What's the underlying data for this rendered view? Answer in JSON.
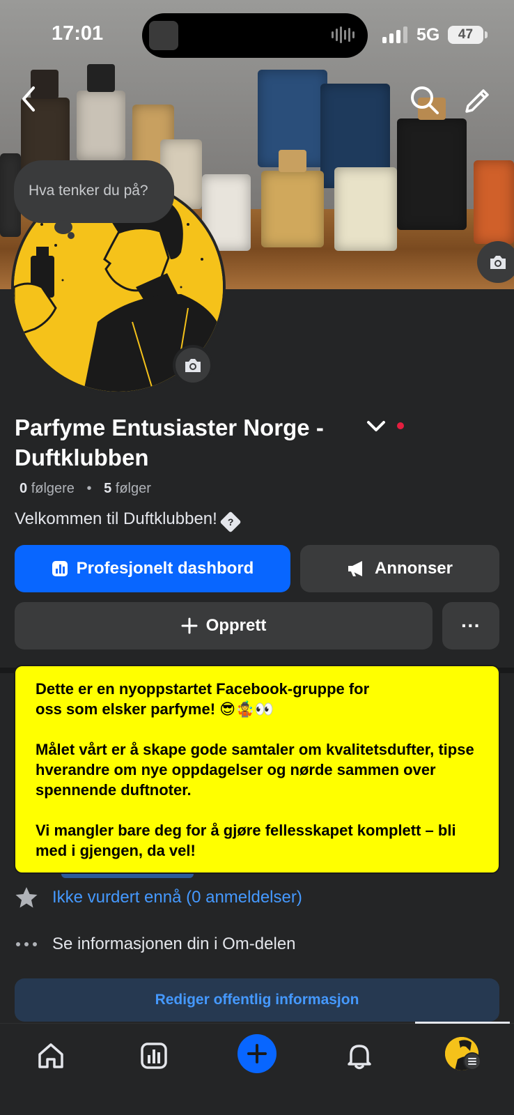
{
  "status_bar": {
    "time": "17:01",
    "network": "5G",
    "battery": "47"
  },
  "header": {
    "back_icon": "chevron-left-icon",
    "search_icon": "search-icon",
    "edit_icon": "pencil-icon"
  },
  "cover": {
    "camera_icon": "camera-icon"
  },
  "thought_bubble": {
    "placeholder": "Hva tenker du på?"
  },
  "profile": {
    "name": "Parfyme Entusiaster Norge - Duftklubben",
    "followers_count": "0",
    "followers_label": "følgere",
    "following_count": "5",
    "following_label": "følger",
    "bio": "Velkommen til Duftklubben!",
    "bio_glyph": "?"
  },
  "actions": {
    "dashboard_label": "Profesjonelt dashbord",
    "ads_label": "Annonser",
    "create_label": "Opprett",
    "more_label": "···"
  },
  "announcement": {
    "paragraph1": "Dette er en nyoppstartet Facebook-gruppe for oss som elsker parfyme! 😎🤹👀",
    "paragraph2": "Målet vårt er å skape gode samtaler om kvalitetsdufter, tipse hverandre om nye oppdagelser og nørde sammen over spennende duftnoter.",
    "paragraph3": "Vi mangler bare deg for å gjøre fellesskapet komplett – bli med i gjengen, da vel!"
  },
  "info": {
    "rating_text": "Ikke vurdert ennå (0 anmeldelser)",
    "about_text": "Se informasjonen din i Om-delen",
    "edit_button": "Rediger offentlig informasjon"
  },
  "tabbar": {
    "items": [
      "home-icon",
      "insights-icon",
      "create-icon",
      "notifications-icon",
      "profile-avatar"
    ]
  },
  "colors": {
    "background": "#242526",
    "primary": "#0866ff",
    "secondary_button": "#3a3b3c",
    "link": "#4599ff",
    "announcement": "#ffff00",
    "notification_dot": "#e41e3f"
  }
}
